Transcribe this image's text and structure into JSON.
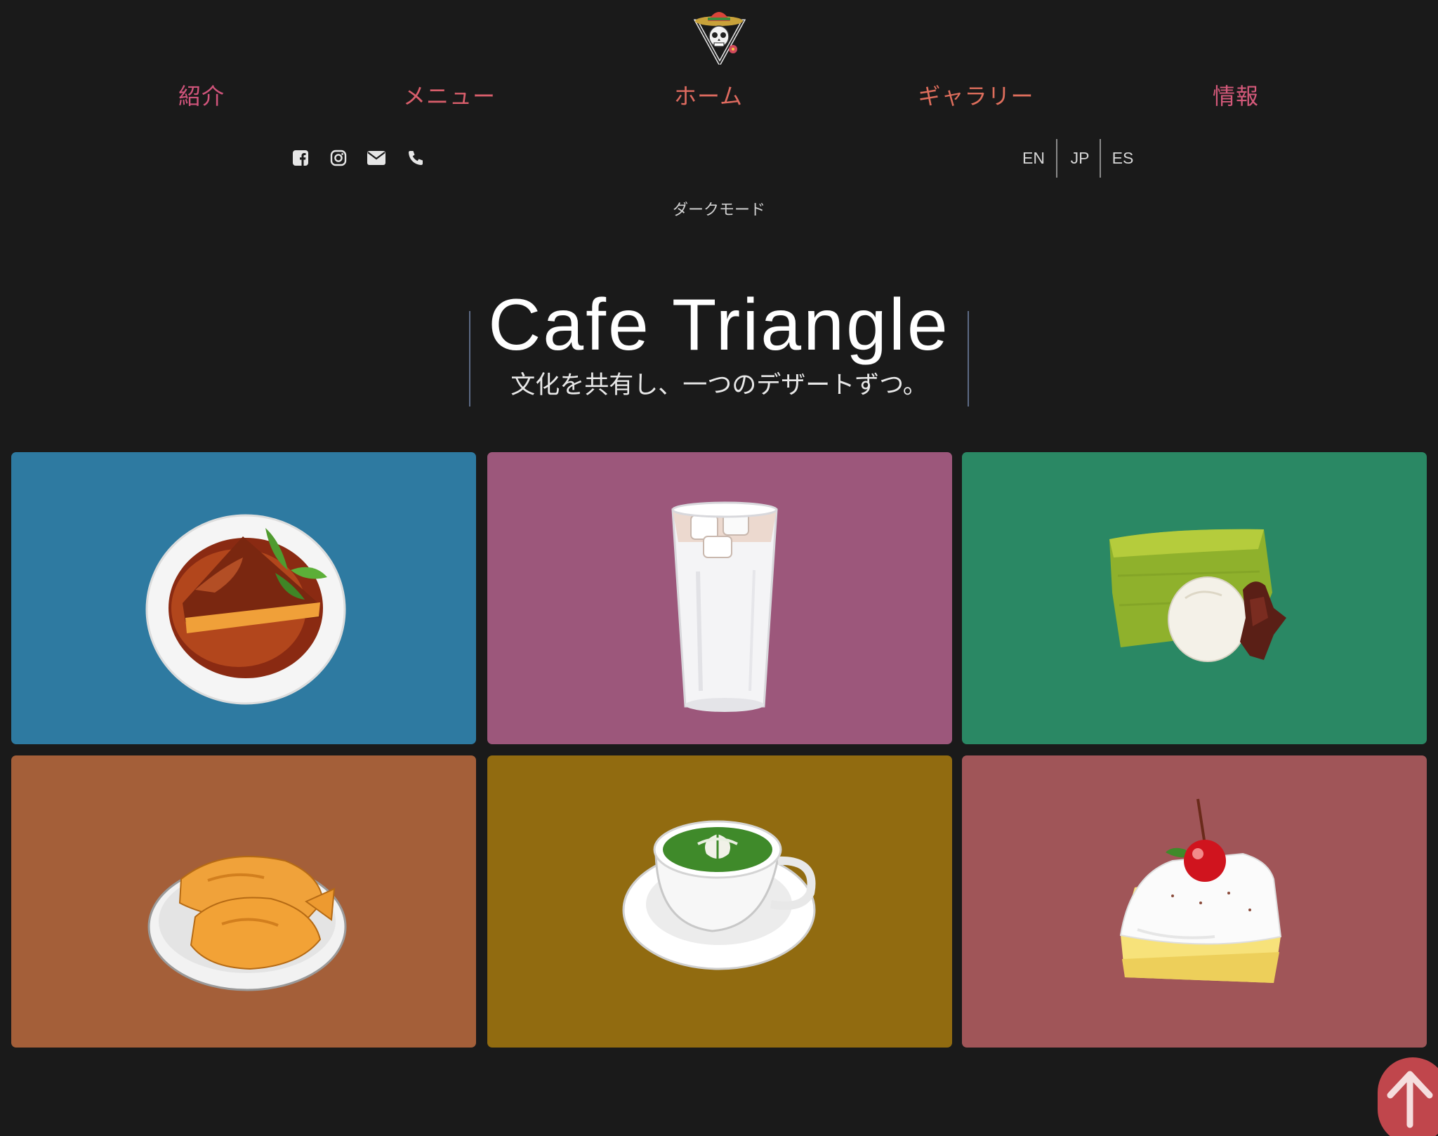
{
  "colors": {
    "background": "#1a1a1a",
    "nav_gradient_start": "#d0547b",
    "nav_gradient_end": "#e07958",
    "text_light": "#d6d6d6",
    "back_to_top": "#c0464c"
  },
  "nav": {
    "items": [
      {
        "label": "紹介",
        "color": "#d0547b"
      },
      {
        "label": "メニュー",
        "color": "#d95e6b"
      },
      {
        "label": "ホーム",
        "color": "#dd6a5f"
      },
      {
        "label": "ギャラリー",
        "color": "#de6e5c"
      },
      {
        "label": "情報",
        "color": "#d4597a"
      }
    ]
  },
  "socials": [
    "facebook-icon",
    "instagram-icon",
    "email-icon",
    "phone-icon"
  ],
  "languages": [
    "EN",
    "JP",
    "ES"
  ],
  "dark_mode_label": "ダークモード",
  "hero": {
    "title": "Cafe Triangle",
    "subtitle": "文化を共有し、一つのデザートずつ。"
  },
  "gallery": [
    {
      "name": "caramel-flan-tile",
      "color": "#2e7aa1",
      "icon": "flan-icon"
    },
    {
      "name": "iced-horchata-tile",
      "color": "#9c577b",
      "icon": "iced-drink-icon"
    },
    {
      "name": "matcha-cake-tile",
      "color": "#2a8864",
      "icon": "matcha-cake-icon"
    },
    {
      "name": "taiyaki-tile",
      "color": "#a45f39",
      "icon": "taiyaki-icon"
    },
    {
      "name": "matcha-latte-tile",
      "color": "#916b10",
      "icon": "latte-icon"
    },
    {
      "name": "tres-leches-tile",
      "color": "#a05558",
      "icon": "cake-slice-icon"
    }
  ],
  "back_to_top_icon": "arrow-up-icon"
}
